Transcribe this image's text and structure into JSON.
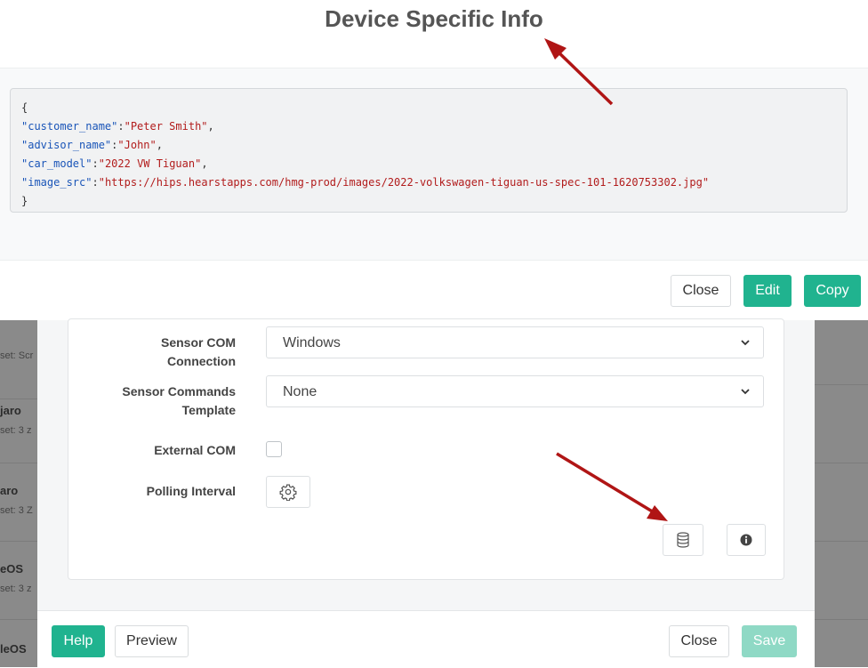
{
  "device_info": {
    "title": "Device Specific Info",
    "json": {
      "open": "{",
      "close": "}",
      "lines": [
        {
          "key": "\"customer_name\"",
          "value": "\"Peter Smith\""
        },
        {
          "key": "\"advisor_name\"",
          "value": "\"John\""
        },
        {
          "key": "\"car_model\"",
          "value": "\"2022 VW Tiguan\""
        },
        {
          "key": "\"image_src\"",
          "value": "\"https://hips.hearstapps.com/hmg-prod/images/2022-volkswagen-tiguan-us-spec-101-1620753302.jpg\""
        }
      ]
    },
    "buttons": {
      "close": "Close",
      "edit": "Edit",
      "copy": "Copy"
    }
  },
  "background_list": [
    {
      "title": "",
      "subtitle": "set: Scr"
    },
    {
      "title": "jaro",
      "subtitle": "set: 3 z"
    },
    {
      "title": "aro",
      "subtitle": "set: 3 Z"
    },
    {
      "title": "eOS",
      "subtitle": "set: 3 z"
    },
    {
      "title": "leOS",
      "subtitle": ""
    }
  ],
  "form": {
    "sensor_com_connection": {
      "label": "Sensor COM Connection",
      "value": "Windows"
    },
    "sensor_commands_template": {
      "label_line1": "Sensor Commands",
      "label_line2": "Template",
      "value": "None"
    },
    "external_com": {
      "label": "External COM",
      "checked": false
    },
    "polling_interval": {
      "label": "Polling Interval",
      "icon": "gear-icon"
    },
    "tool_icons": [
      "database-icon",
      "info-icon"
    ]
  },
  "footer": {
    "help": "Help",
    "preview": "Preview",
    "close": "Close",
    "save": "Save"
  },
  "colors": {
    "accent": "#20b38f",
    "accent_disabled": "#8fd9c5",
    "annotation_arrow": "#b01515",
    "json_key": "#1a55b8",
    "json_string": "#b21c1c"
  }
}
